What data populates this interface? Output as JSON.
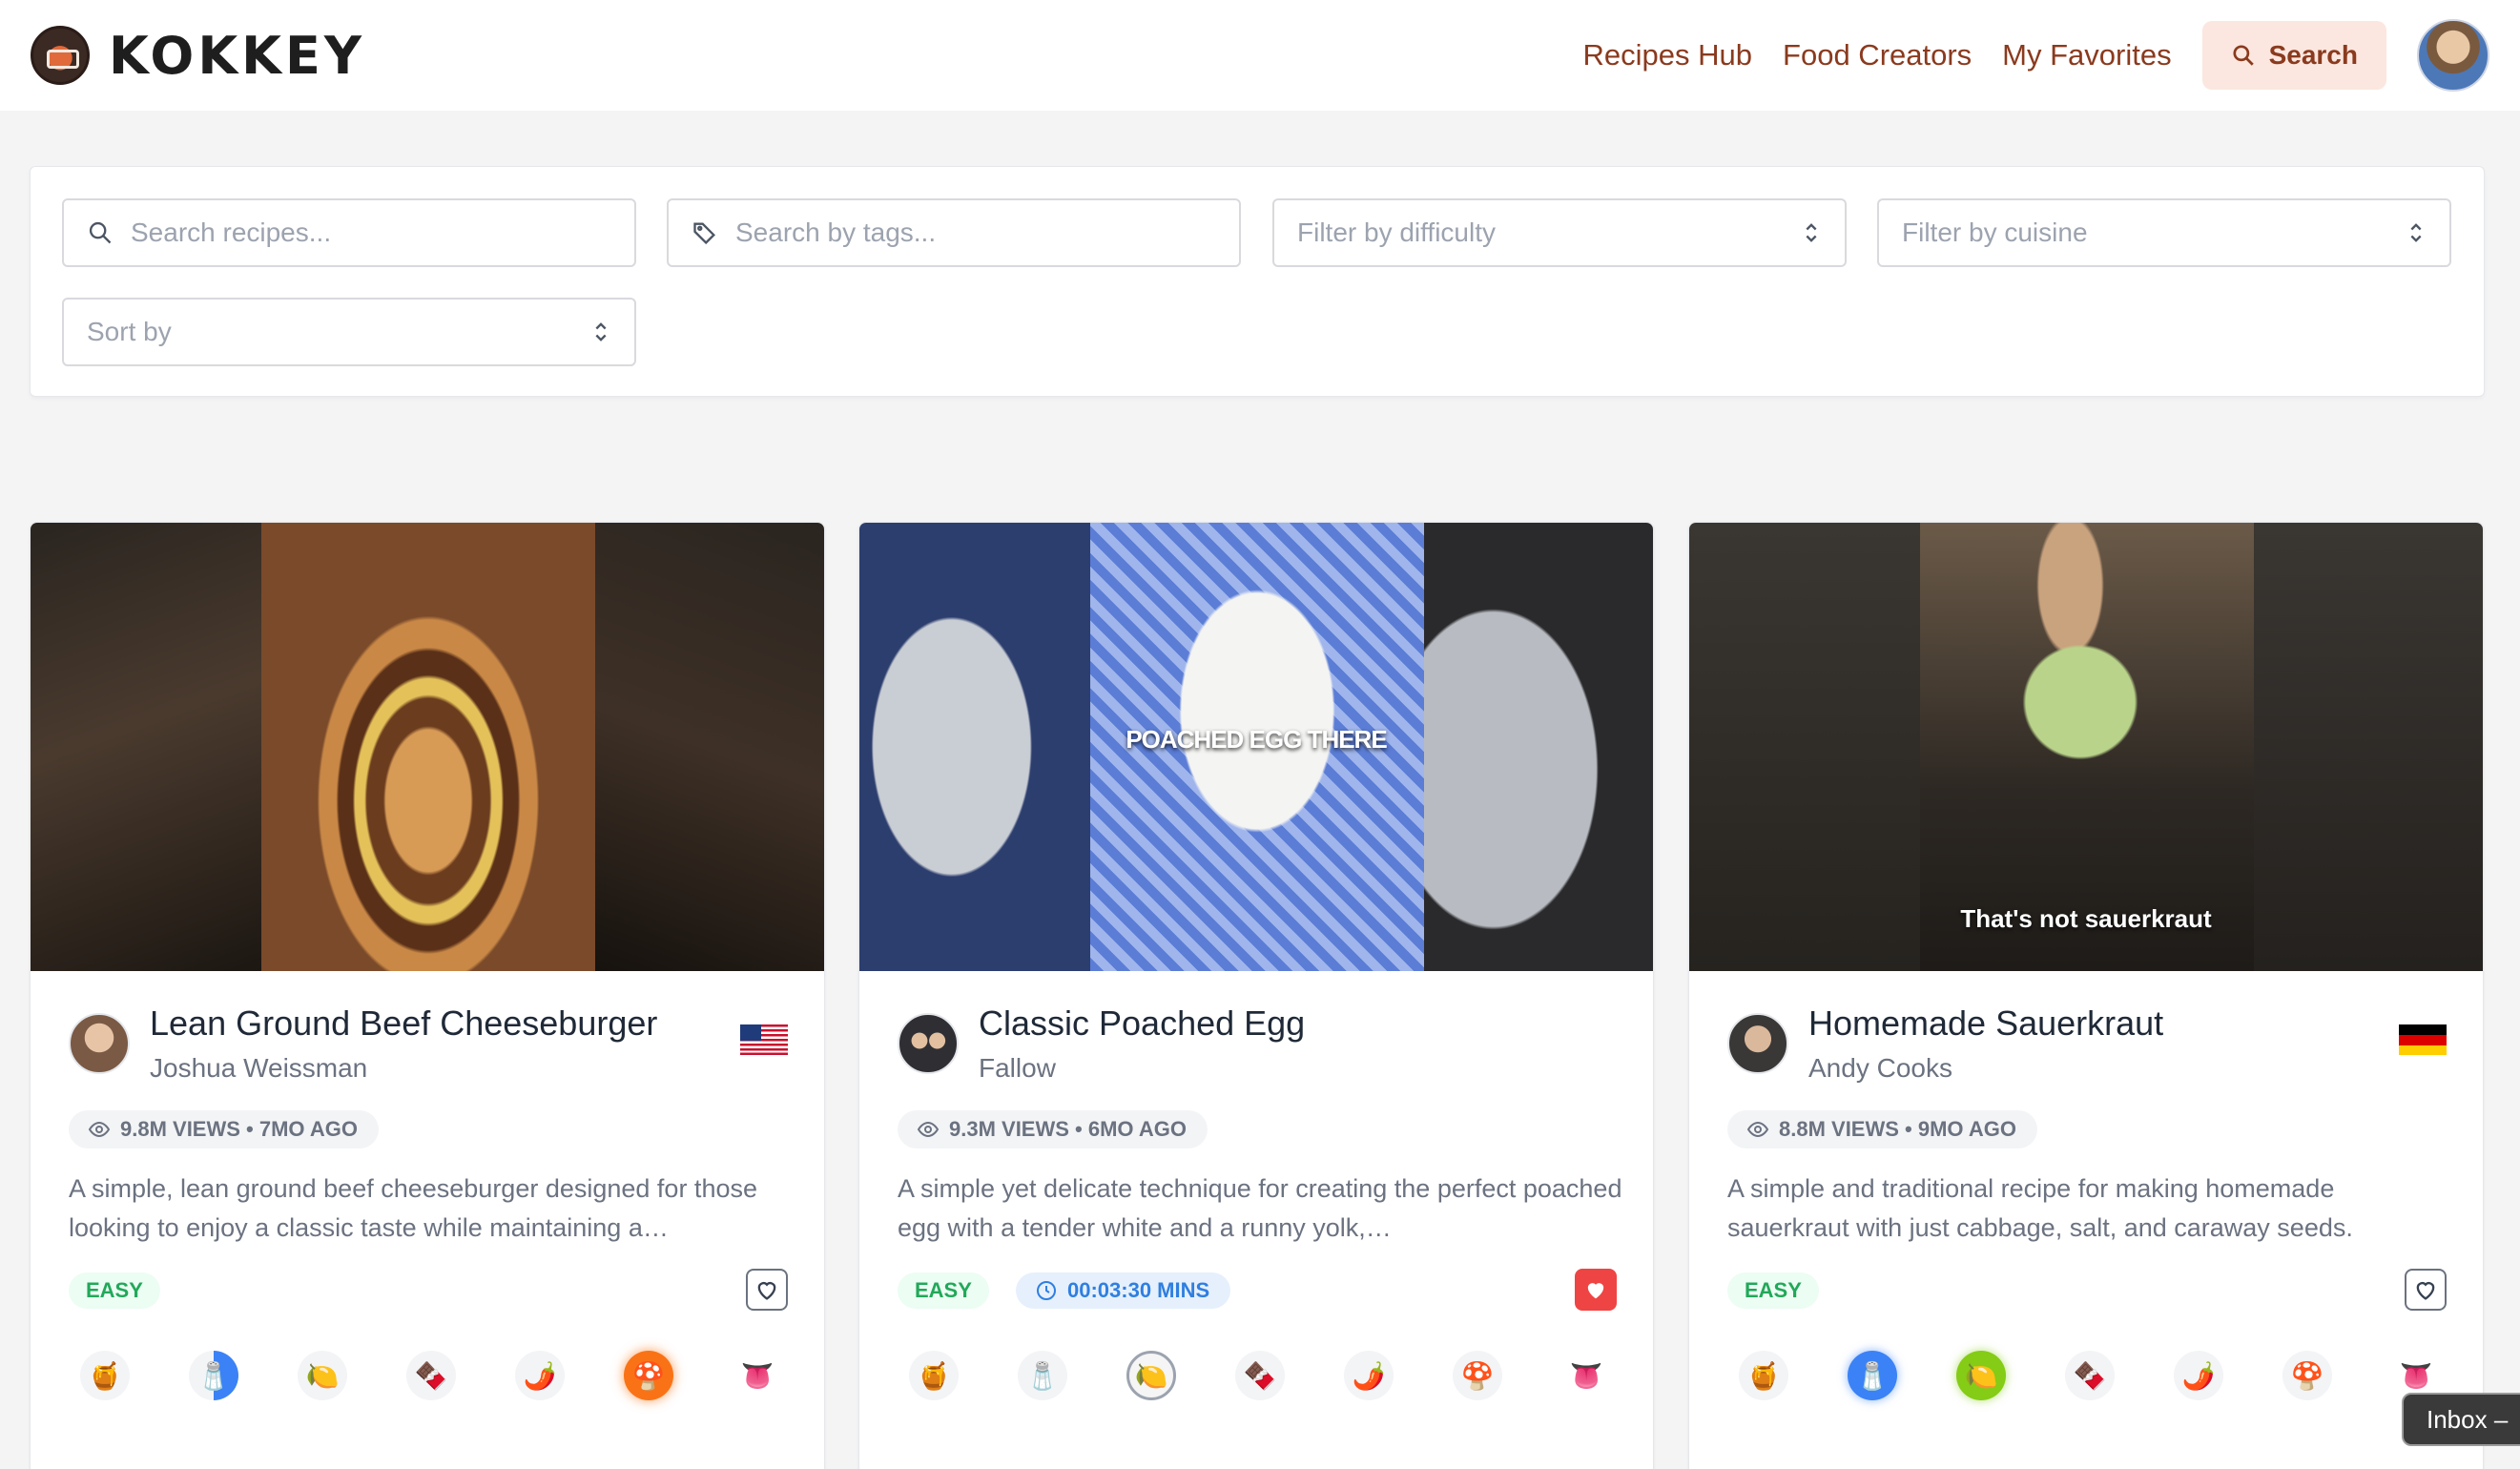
{
  "brand": {
    "name": "KOKKEY"
  },
  "nav": {
    "links": [
      "Recipes Hub",
      "Food Creators",
      "My Favorites"
    ],
    "search_label": "Search",
    "accent_color": "#8a3a1e"
  },
  "filters": {
    "search_placeholder": "Search recipes...",
    "tags_placeholder": "Search by tags...",
    "difficulty_placeholder": "Filter by difficulty",
    "cuisine_placeholder": "Filter by cuisine",
    "sort_placeholder": "Sort by"
  },
  "cards": [
    {
      "title": "Lean Ground Beef Cheeseburger",
      "creator": "Joshua Weissman",
      "flag": "us-flag",
      "stats": "9.8M VIEWS • 7MO AGO",
      "description": "A simple, lean ground beef cheeseburger designed for those looking to enjoy a classic taste while maintaining a…",
      "difficulty": "EASY",
      "favorited": false,
      "tastes": [
        "🍯",
        "🧂",
        "🍋",
        "🍫",
        "🌶️",
        "🍄",
        "👅"
      ]
    },
    {
      "title": "Classic Poached Egg",
      "creator": "Fallow",
      "flag": "",
      "stats": "9.3M VIEWS • 6MO AGO",
      "description": "A simple yet delicate technique for creating the perfect poached egg with a tender white and a runny yolk,…",
      "difficulty": "EASY",
      "time": "00:03:30 MINS",
      "caption": "POACHED EGG THERE",
      "favorited": true,
      "tastes": [
        "🍯",
        "🧂",
        "🍋",
        "🍫",
        "🌶️",
        "🍄",
        "👅"
      ]
    },
    {
      "title": "Homemade Sauerkraut",
      "creator": "Andy Cooks",
      "flag": "de-flag",
      "stats": "8.8M VIEWS • 9MO AGO",
      "description": "A simple and traditional recipe for making homemade sauerkraut with just cabbage, salt, and caraway seeds.",
      "difficulty": "EASY",
      "caption": "That's not sauerkraut",
      "favorited": false,
      "tastes": [
        "🍯",
        "🧂",
        "🍋",
        "🍫",
        "🌶️",
        "🍄",
        "👅"
      ]
    }
  ],
  "tooltip": {
    "label": "Inbox –"
  }
}
